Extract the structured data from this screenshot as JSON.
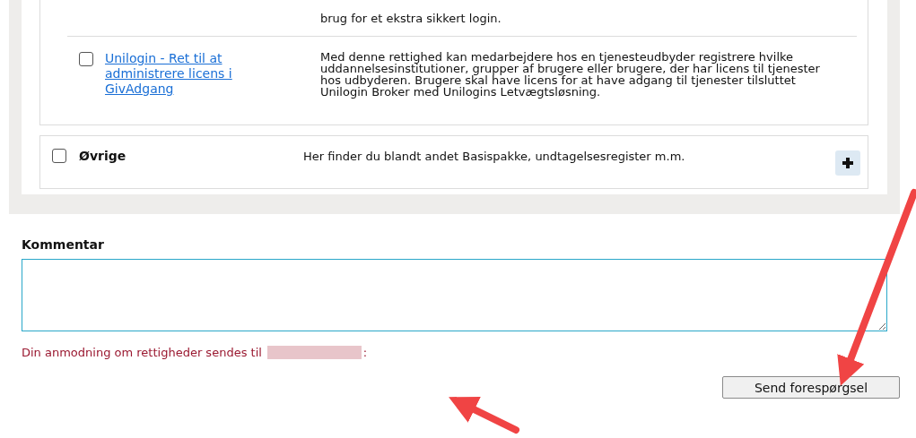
{
  "permissions_card": {
    "cut_row": {
      "description": "brug for et ekstra sikkert login."
    },
    "rows": [
      {
        "label": "Unilogin - Ret til at administrere licens i GivAdgang",
        "description": "Med denne rettighed kan medarbejdere hos en tjenesteudbyder registrere hvilke uddannelsesinstitutioner, grupper af brugere eller brugere, der har licens til tjenester hos udbyderen. Brugere skal have licens for at have adgang til tjenester tilsluttet Unilogin Broker med Unilogins Letvægtsløsning.",
        "checked": false
      }
    ]
  },
  "groups": [
    {
      "label": "Øvrige",
      "description": "Her finder du blandt andet Basispakke, undtagelsesregister m.m.",
      "checked": false,
      "expanded": false
    }
  ],
  "comment": {
    "label": "Kommentar"
  },
  "notice": {
    "before": "Din anmodning om rettigheder sendes til",
    "after": ":"
  },
  "submit_button": "Send forespørgsel"
}
